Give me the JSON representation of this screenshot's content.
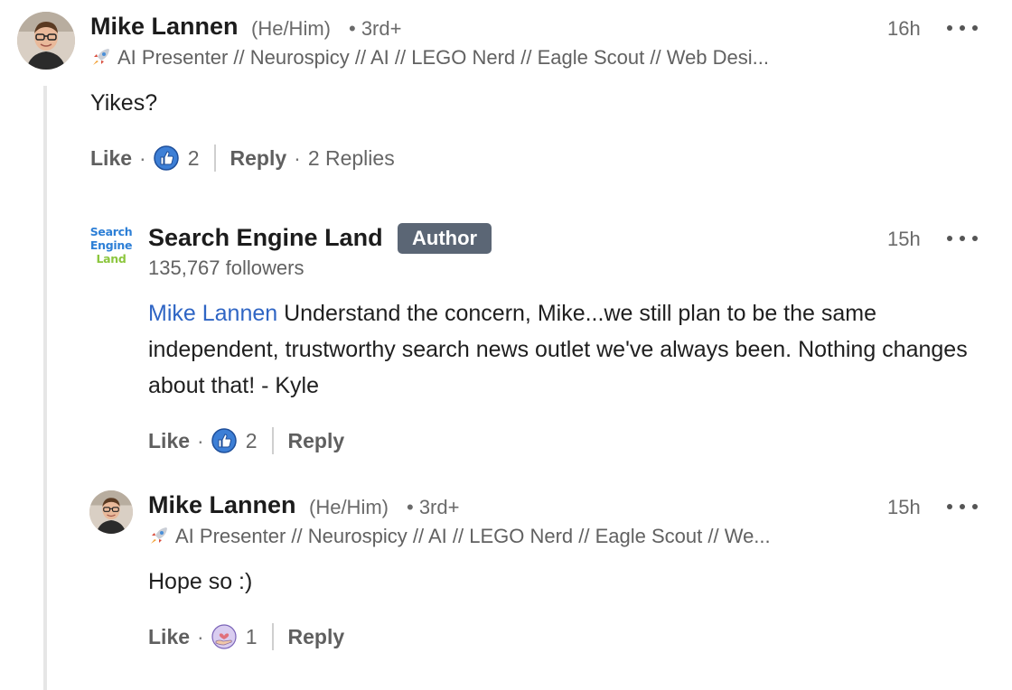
{
  "comments": [
    {
      "name": "Mike Lannen",
      "pronouns": "(He/Him)",
      "degree": "• 3rd+",
      "headline": "AI Presenter // Neurospicy // AI // LEGO Nerd // Eagle Scout // Web Desi...",
      "time": "16h",
      "text": "Yikes?",
      "actions": {
        "like": "Like",
        "reaction_count": "2",
        "reply": "Reply",
        "replies": "2 Replies"
      }
    }
  ],
  "replies": [
    {
      "name": "Search Engine Land",
      "badge": "Author",
      "followers": "135,767 followers",
      "logo": [
        "Search",
        "Engine",
        "Land"
      ],
      "logo_colors": [
        "#2d7fd6",
        "#2d7fd6",
        "#8cc63e"
      ],
      "time": "15h",
      "mention": "Mike Lannen",
      "text": " Understand the concern, Mike...we still plan to be the same independent, trustworthy search news outlet we've always been. Nothing changes about that! - Kyle",
      "actions": {
        "like": "Like",
        "reaction_count": "2",
        "reply": "Reply"
      }
    },
    {
      "name": "Mike Lannen",
      "pronouns": "(He/Him)",
      "degree": "• 3rd+",
      "headline": "AI Presenter // Neurospicy // AI // LEGO Nerd // Eagle Scout // We...",
      "time": "15h",
      "text": "Hope so :)",
      "actions": {
        "like": "Like",
        "reaction_count": "1",
        "reply": "Reply"
      }
    }
  ],
  "colors": {
    "mention": "#2f65c4",
    "badge": "#5b6675",
    "like_icon": "#3d7fd6"
  },
  "icons": {
    "reaction_1": "like-thumbs-up-icon",
    "reaction_3": "support-heart-hand-icon",
    "headline_emoji": "rocket-icon",
    "menu": "more-options-icon"
  }
}
